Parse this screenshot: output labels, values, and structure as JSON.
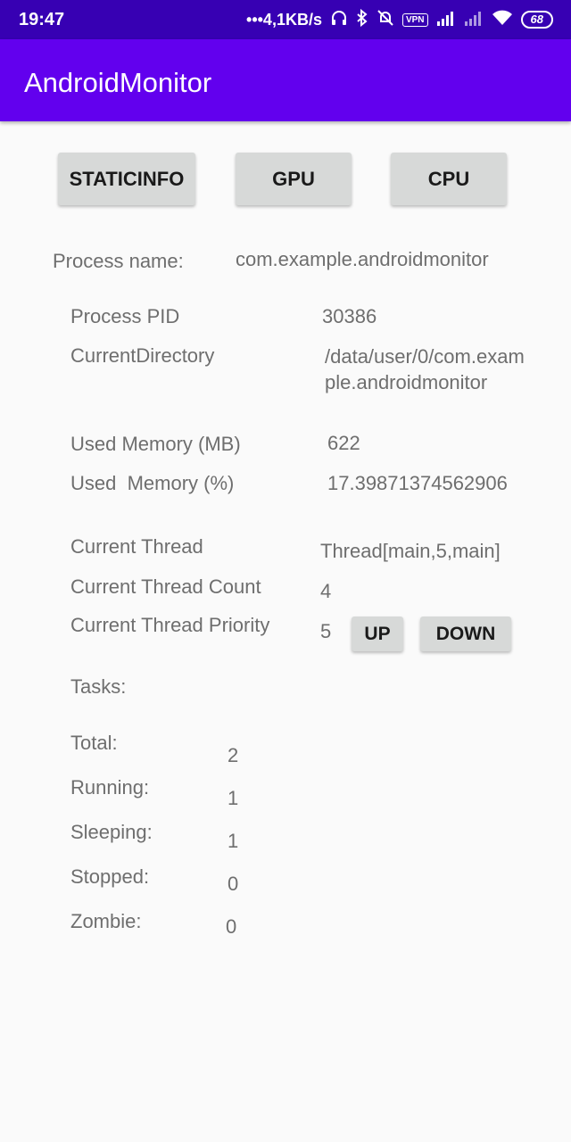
{
  "status_bar": {
    "time": "19:47",
    "net_speed": "•••4,1KB/s",
    "vpn": "VPN",
    "battery": "68"
  },
  "app_bar": {
    "title": "AndroidMonitor"
  },
  "tabs": {
    "static_info": "STATICINFO",
    "gpu": "GPU",
    "cpu": "CPU"
  },
  "process": {
    "name_label": "Process name:",
    "name_value": "com.example.androidmonitor",
    "pid_label": "Process PID",
    "pid_value": "30386",
    "dir_label": "CurrentDirectory",
    "dir_value_line1": "/data/user/0/com.exam",
    "dir_value_line2": "ple.androidmonitor"
  },
  "memory": {
    "used_mb_label": "Used Memory (MB)",
    "used_mb_value": "622",
    "used_pct_label": "Used  Memory (%)",
    "used_pct_value": "17.39871374562906"
  },
  "thread": {
    "current_label": "Current Thread",
    "current_value": "Thread[main,5,main]",
    "count_label": "Current Thread Count",
    "count_value": "4",
    "priority_label": "Current Thread Priority",
    "priority_value": "5",
    "up_label": "UP",
    "down_label": "DOWN"
  },
  "tasks": {
    "title": "Tasks:",
    "total_label": "Total:",
    "total_value": "2",
    "running_label": "Running:",
    "running_value": "1",
    "sleeping_label": "Sleeping:",
    "sleeping_value": "1",
    "stopped_label": "Stopped:",
    "stopped_value": "0",
    "zombie_label": "Zombie:",
    "zombie_value": "0"
  }
}
